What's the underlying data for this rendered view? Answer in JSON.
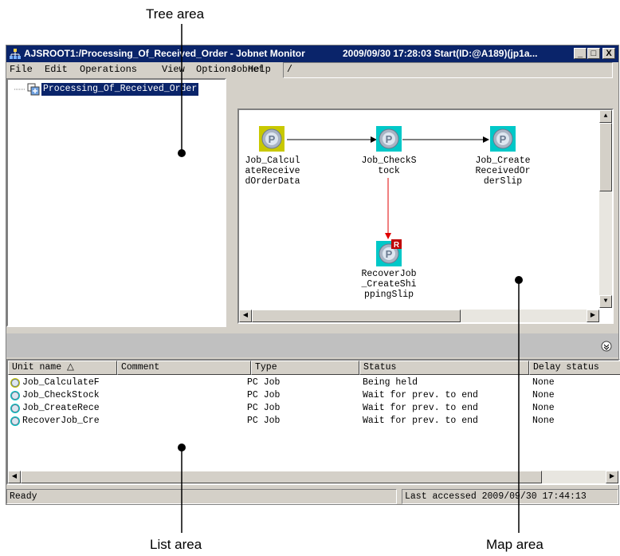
{
  "callouts": {
    "tree": "Tree area",
    "list": "List area",
    "map": "Map area"
  },
  "window": {
    "title": "AJSROOT1:/Processing_Of_Received_Order - Jobnet Monitor",
    "title_right": "2009/09/30 17:28:03 Start(ID:@A189)(jp1a...",
    "minimize": "_",
    "maximize": "□",
    "close": "X"
  },
  "menu": [
    "File",
    "Edit",
    "Operations",
    "View",
    "Options",
    "Help"
  ],
  "tree": {
    "node": "Processing_Of_Received_Order"
  },
  "jobnet": {
    "label": "Jobnet",
    "value": "/"
  },
  "map": {
    "jobs": [
      {
        "label": "Job_Calcul\nateReceive\ndOrderData",
        "icon_letter": "P",
        "frame": "#c8c800"
      },
      {
        "label": "Job_CheckS\ntock",
        "icon_letter": "P",
        "frame": "#00c8c8"
      },
      {
        "label": "Job_Create\nReceivedOr\nderSlip",
        "icon_letter": "P",
        "frame": "#00c8c8"
      },
      {
        "label": "RecoverJob\n_CreateShi\nppingSlip",
        "icon_letter": "P",
        "badge": "R",
        "frame": "#00c8c8"
      }
    ],
    "arrow_color_normal": "#000000",
    "arrow_color_recovery": "#e00000"
  },
  "list": {
    "columns": [
      "Unit name △",
      "Comment",
      "Type",
      "Status",
      "Delay status"
    ],
    "rows": [
      {
        "name": "Job_CalculateF",
        "comment": "",
        "type": "PC Job",
        "status": "Being held",
        "delay": "None",
        "dot": "#c8c800"
      },
      {
        "name": "Job_CheckStock",
        "comment": "",
        "type": "PC Job",
        "status": "Wait for prev. to end",
        "delay": "None",
        "dot": "#00c8c8"
      },
      {
        "name": "Job_CreateRece",
        "comment": "",
        "type": "PC Job",
        "status": "Wait for prev. to end",
        "delay": "None",
        "dot": "#00c8c8"
      },
      {
        "name": "RecoverJob_Cre",
        "comment": "",
        "type": "PC Job",
        "status": "Wait for prev. to end",
        "delay": "None",
        "dot": "#00c8c8"
      }
    ]
  },
  "status": {
    "left": "Ready",
    "right": "Last accessed 2009/09/30 17:44:13"
  }
}
